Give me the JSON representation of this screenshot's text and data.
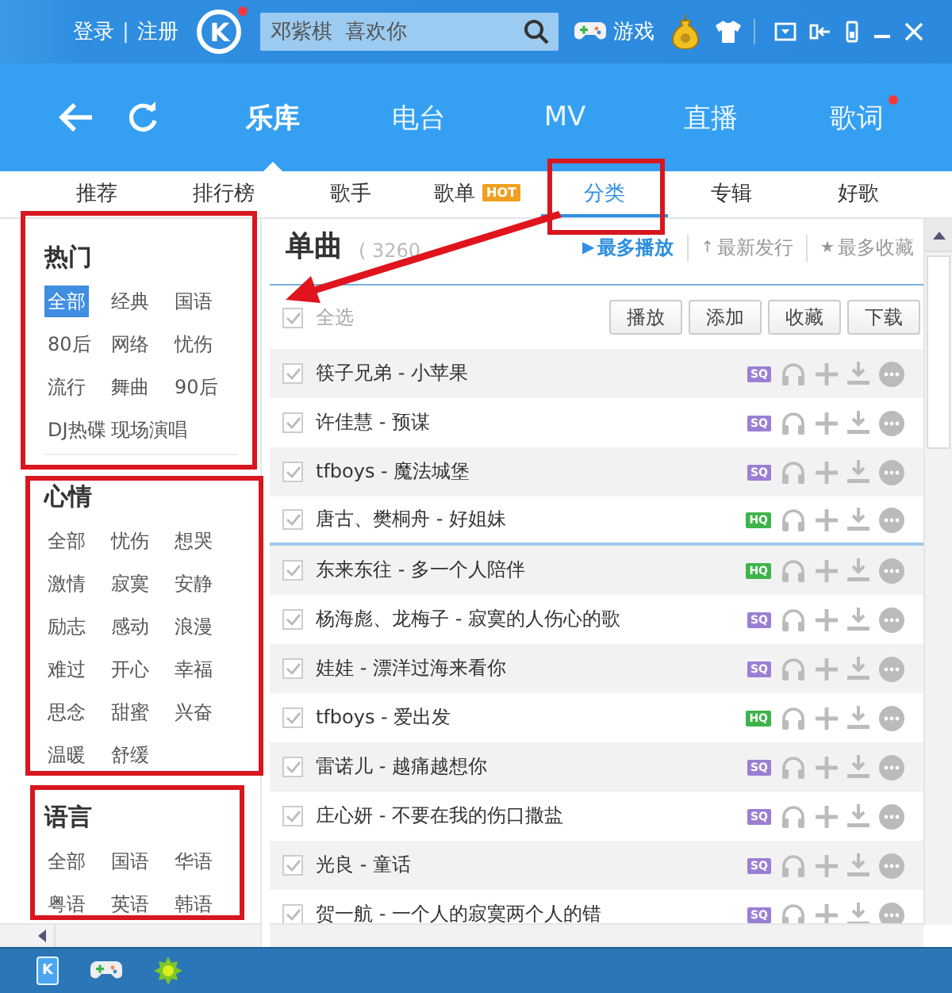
{
  "top_bar": {
    "login": "登录",
    "separator": "|",
    "register": "注册",
    "logo": "K",
    "logo_notification": true,
    "search": {
      "placeholder": "邓紫棋  喜欢你"
    },
    "games": "游戏"
  },
  "nav": {
    "tabs": [
      {
        "label": "乐库",
        "selected": true,
        "notification": false
      },
      {
        "label": "电台",
        "selected": false,
        "notification": false
      },
      {
        "label": "MV",
        "selected": false,
        "notification": false
      },
      {
        "label": "直播",
        "selected": false,
        "notification": false
      },
      {
        "label": "歌词",
        "selected": false,
        "notification": true
      }
    ]
  },
  "sub_tabs": [
    {
      "label": "推荐",
      "selected": false
    },
    {
      "label": "排行榜",
      "selected": false
    },
    {
      "label": "歌手",
      "selected": false
    },
    {
      "label": "歌单",
      "selected": false,
      "tag": "HOT"
    },
    {
      "label": "分类",
      "selected": true
    },
    {
      "label": "专辑",
      "selected": false
    },
    {
      "label": "好歌",
      "selected": false
    }
  ],
  "categories": [
    {
      "title": "热门",
      "tags": [
        {
          "label": "全部",
          "selected": true
        },
        {
          "label": "经典",
          "selected": false
        },
        {
          "label": "国语",
          "selected": false
        },
        {
          "label": "80后",
          "selected": false
        },
        {
          "label": "网络",
          "selected": false
        },
        {
          "label": "忧伤",
          "selected": false
        },
        {
          "label": "流行",
          "selected": false
        },
        {
          "label": "舞曲",
          "selected": false
        },
        {
          "label": "90后",
          "selected": false
        },
        {
          "label": "DJ热碟",
          "selected": false
        },
        {
          "label": "现场演唱",
          "selected": false
        }
      ]
    },
    {
      "title": "心情",
      "tags": [
        {
          "label": "全部",
          "selected": false
        },
        {
          "label": "忧伤",
          "selected": false
        },
        {
          "label": "想哭",
          "selected": false
        },
        {
          "label": "激情",
          "selected": false
        },
        {
          "label": "寂寞",
          "selected": false
        },
        {
          "label": "安静",
          "selected": false
        },
        {
          "label": "励志",
          "selected": false
        },
        {
          "label": "感动",
          "selected": false
        },
        {
          "label": "浪漫",
          "selected": false
        },
        {
          "label": "难过",
          "selected": false
        },
        {
          "label": "开心",
          "selected": false
        },
        {
          "label": "幸福",
          "selected": false
        },
        {
          "label": "思念",
          "selected": false
        },
        {
          "label": "甜蜜",
          "selected": false
        },
        {
          "label": "兴奋",
          "selected": false
        },
        {
          "label": "温暖",
          "selected": false
        },
        {
          "label": "舒缓",
          "selected": false
        }
      ]
    },
    {
      "title": "语言",
      "tags": [
        {
          "label": "全部",
          "selected": false
        },
        {
          "label": "国语",
          "selected": false
        },
        {
          "label": "华语",
          "selected": false
        },
        {
          "label": "粤语",
          "selected": false
        },
        {
          "label": "英语",
          "selected": false
        },
        {
          "label": "韩语",
          "selected": false
        }
      ]
    }
  ],
  "songs": {
    "title": "单曲",
    "count": "( 3260",
    "sorts": [
      {
        "icon": "▶",
        "label": "最多播放",
        "selected": true
      },
      {
        "icon": "↑",
        "label": "最新发行",
        "selected": false
      },
      {
        "icon": "★",
        "label": "最多收藏",
        "selected": false
      }
    ],
    "select_all": {
      "label": "全选",
      "checked": true
    },
    "actions": [
      "播放",
      "添加",
      "收藏",
      "下载"
    ],
    "rows": [
      {
        "title": "筷子兄弟  - 小苹果",
        "checked": true,
        "quality": {
          "label": "SQ",
          "color": "#9b7fd4"
        }
      },
      {
        "title": "许佳慧  - 预谋",
        "checked": true,
        "quality": {
          "label": "SQ",
          "color": "#9b7fd4"
        }
      },
      {
        "title": "tfboys - 魔法城堡",
        "checked": true,
        "quality": {
          "label": "SQ",
          "color": "#9b7fd4"
        }
      },
      {
        "title": "唐古、樊桐舟  - 好姐妹",
        "checked": true,
        "quality": {
          "label": "HQ",
          "color": "#3cb44a"
        }
      },
      {
        "title": "东来东往  - 多一个人陪伴",
        "checked": true,
        "quality": {
          "label": "HQ",
          "color": "#3cb44a"
        }
      },
      {
        "title": "杨海彪、龙梅子  - 寂寞的人伤心的歌",
        "checked": true,
        "quality": {
          "label": "SQ",
          "color": "#9b7fd4"
        }
      },
      {
        "title": "娃娃  - 漂洋过海来看你",
        "checked": true,
        "quality": {
          "label": "SQ",
          "color": "#9b7fd4"
        }
      },
      {
        "title": "tfboys - 爱出发",
        "checked": true,
        "quality": {
          "label": "HQ",
          "color": "#3cb44a"
        }
      },
      {
        "title": "雷诺儿  - 越痛越想你",
        "checked": true,
        "quality": {
          "label": "SQ",
          "color": "#9b7fd4"
        }
      },
      {
        "title": "庄心妍  - 不要在我的伤口撒盐",
        "checked": true,
        "quality": {
          "label": "SQ",
          "color": "#9b7fd4"
        }
      },
      {
        "title": "光良  - 童话",
        "checked": true,
        "quality": {
          "label": "SQ",
          "color": "#9b7fd4"
        }
      },
      {
        "title": "贺一航  - 一个人的寂寞两个人的错",
        "checked": true,
        "quality": {
          "label": "SQ",
          "color": "#9b7fd4"
        }
      }
    ]
  },
  "taskbar": {
    "app_letter": "K"
  }
}
